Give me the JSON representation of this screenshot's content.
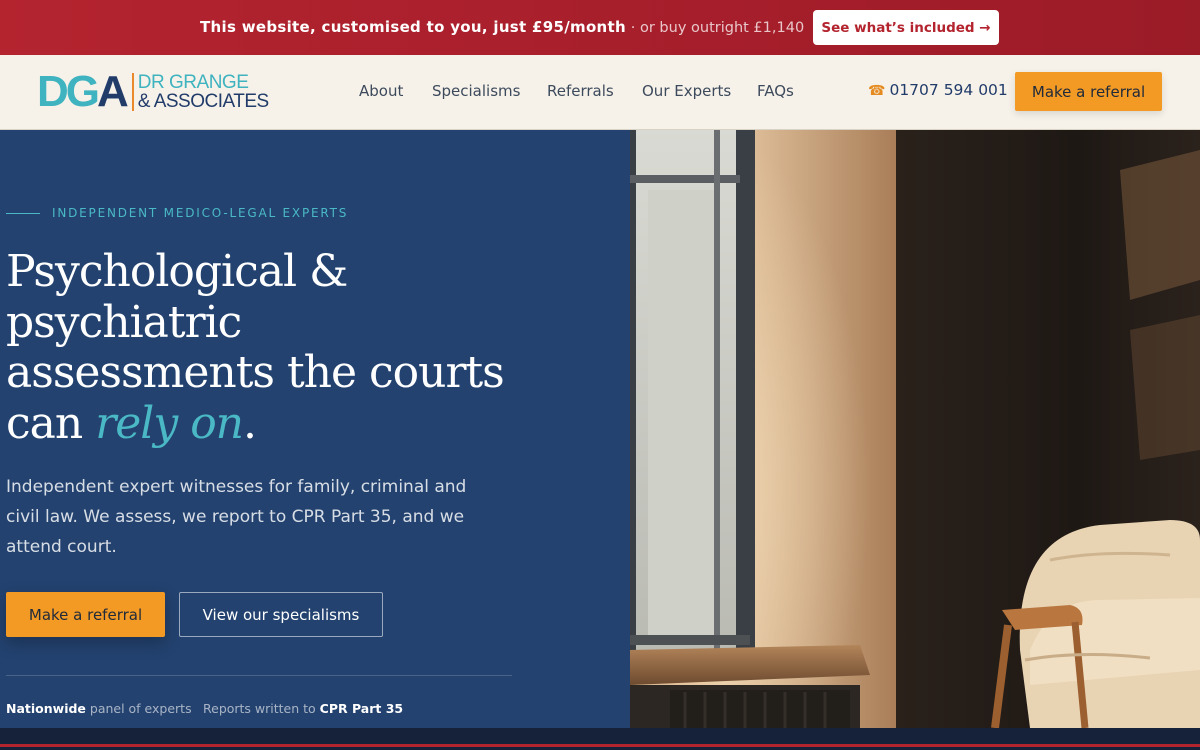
{
  "promo": {
    "headline": "This website, customised to you, just £95/month",
    "secondary": "· or buy outright £1,140",
    "button": "See what’s included →"
  },
  "logo": {
    "mark_d": "D",
    "mark_g": "G",
    "mark_a": "A",
    "line1": "DR GRANGE",
    "line2": "& ASSOCIATES"
  },
  "nav": {
    "items": [
      "About",
      "Specialisms",
      "Referrals",
      "Our Experts",
      "FAQs"
    ]
  },
  "header": {
    "phone_icon": "phone-icon",
    "phone": "01707 594 001",
    "cta": "Make a referral"
  },
  "hero": {
    "eyebrow": "INDEPENDENT MEDICO-LEGAL EXPERTS",
    "headline_line1": "Psychological &",
    "headline_line2": "psychiatric",
    "headline_line3": "assessments the courts",
    "headline_line4_start": "can ",
    "headline_accent": "rely on",
    "headline_end": ".",
    "subtext": "Independent expert witnesses for family, criminal and civil law. We assess, we report to CPR Part 35, and we attend court.",
    "cta_primary": "Make a referral",
    "cta_secondary": "View our specialisms",
    "stats": [
      {
        "strong": "Nationwide",
        "rest": " panel of experts"
      },
      {
        "pre": "Reports written to ",
        "strong": "CPR Part 35"
      }
    ]
  },
  "colors": {
    "promo_red": "#b3242f",
    "header_bg": "#f6f2ea",
    "hero_navy": "#23426f",
    "accent_teal": "#4ab9c5",
    "cta_orange": "#f39a24"
  }
}
